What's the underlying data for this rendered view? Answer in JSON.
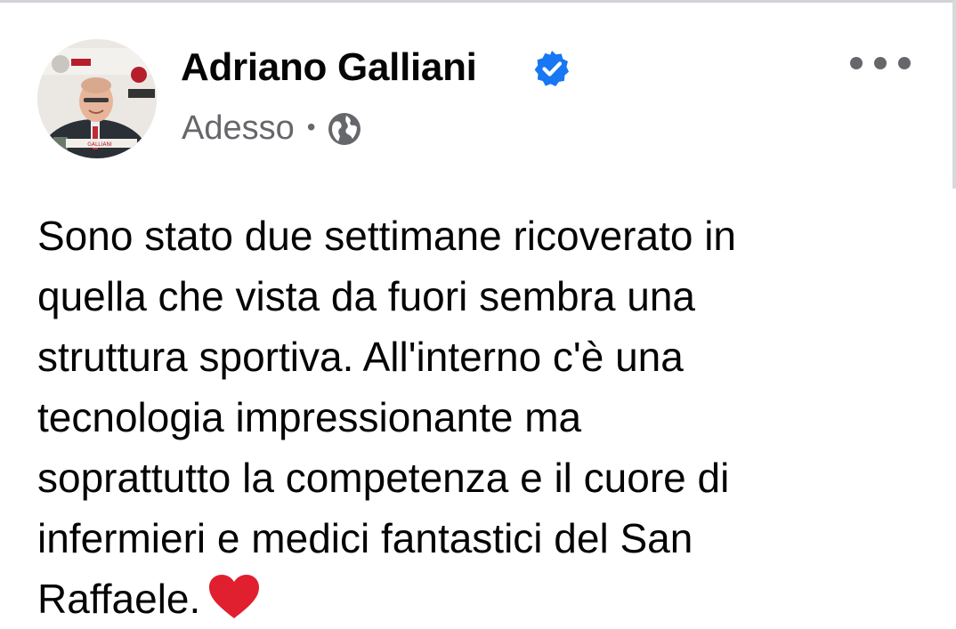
{
  "post": {
    "author": "Adriano Galliani",
    "timestamp": "Adesso",
    "separator": "•",
    "audience_icon": "globe-icon",
    "verified_icon": "verified-badge-icon",
    "more_icon": "more-options-icon",
    "text_lines": [
      "Sono stato due settimane ricoverato in",
      "quella che vista da fuori sembra una",
      "struttura sportiva. All'interno c'è una",
      "tecnologia impressionante ma",
      "soprattutto la competenza e il cuore di",
      "infermieri e medici fantastici del San",
      "Raffaele."
    ],
    "emoji": "red-heart-icon"
  },
  "colors": {
    "verified_blue": "#1877f2",
    "meta_gray": "#65676b",
    "heart_red": "#e0202f"
  }
}
